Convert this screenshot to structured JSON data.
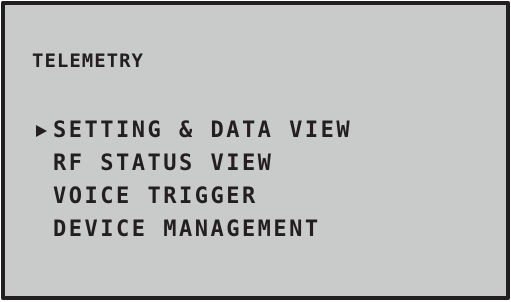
{
  "screen": {
    "title": "TELEMETRY",
    "menu": {
      "items": [
        {
          "label": "SETTING & DATA VIEW",
          "selected": true
        },
        {
          "label": "RF STATUS VIEW",
          "selected": false
        },
        {
          "label": "VOICE TRIGGER",
          "selected": false
        },
        {
          "label": "DEVICE MANAGEMENT",
          "selected": false
        }
      ],
      "cursor_icon": "triangle-right-icon"
    },
    "colors": {
      "background": "#c9caca",
      "text": "#231f20",
      "frame": "#231f20"
    }
  }
}
